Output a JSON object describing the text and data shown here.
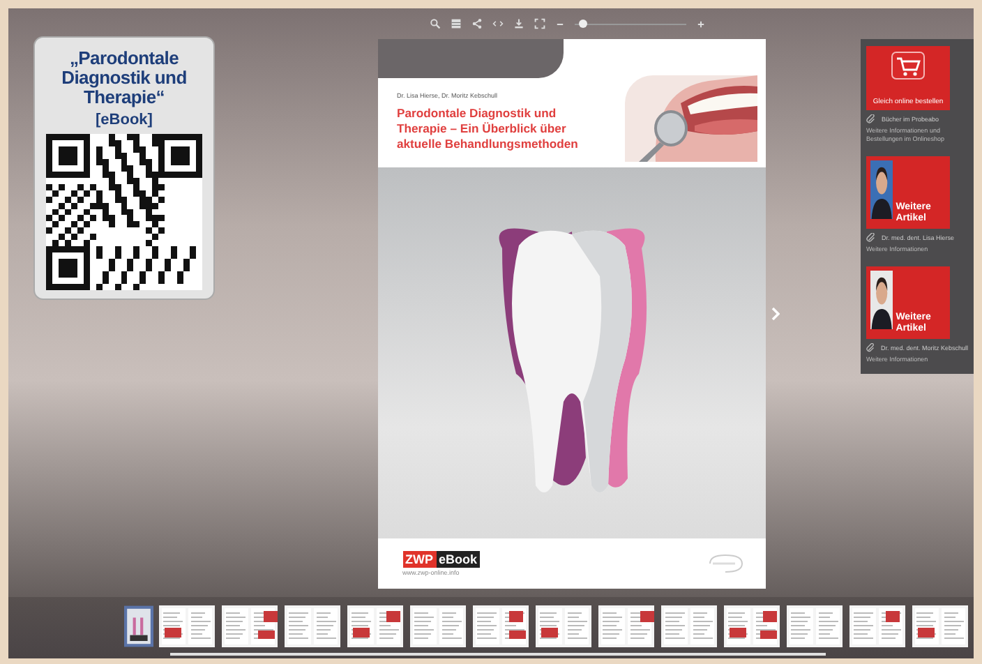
{
  "promo_card": {
    "title": "„Parodontale Diagnostik und Therapie“",
    "subtitle": "[eBook]"
  },
  "toolbar": {
    "zoom": {
      "level": 0.08
    }
  },
  "page": {
    "authors": "Dr. Lisa Hierse, Dr. Moritz Kebschull",
    "title": "Parodontale Diagnostik und Therapie – Ein Überblick über aktuelle Behandlungsmethoden",
    "logo_left": "ZWP",
    "logo_right": "eBook",
    "url": "www.zwp-online.info"
  },
  "sidebar": {
    "items": [
      {
        "kind": "shop",
        "label": "Gleich online bestellen",
        "link": "Bücher im Probeabo",
        "note": "Weitere Informationen und Bestellungen im Onlineshop"
      },
      {
        "kind": "person",
        "label": "Weitere Artikel",
        "link": "Dr. med. dent. Lisa Hierse",
        "note": "Weitere Informationen"
      },
      {
        "kind": "person",
        "label": "Weitere Artikel",
        "link": "Dr. med. dent. Moritz Kebschull",
        "note": "Weitere Informationen"
      }
    ]
  },
  "thumbnails": [
    {
      "selected": true
    },
    {
      "selected": false
    },
    {
      "selected": false
    },
    {
      "selected": false
    },
    {
      "selected": false
    },
    {
      "selected": false
    },
    {
      "selected": false
    },
    {
      "selected": false
    },
    {
      "selected": false
    },
    {
      "selected": false
    },
    {
      "selected": false
    },
    {
      "selected": false
    },
    {
      "selected": false
    },
    {
      "selected": false
    }
  ]
}
